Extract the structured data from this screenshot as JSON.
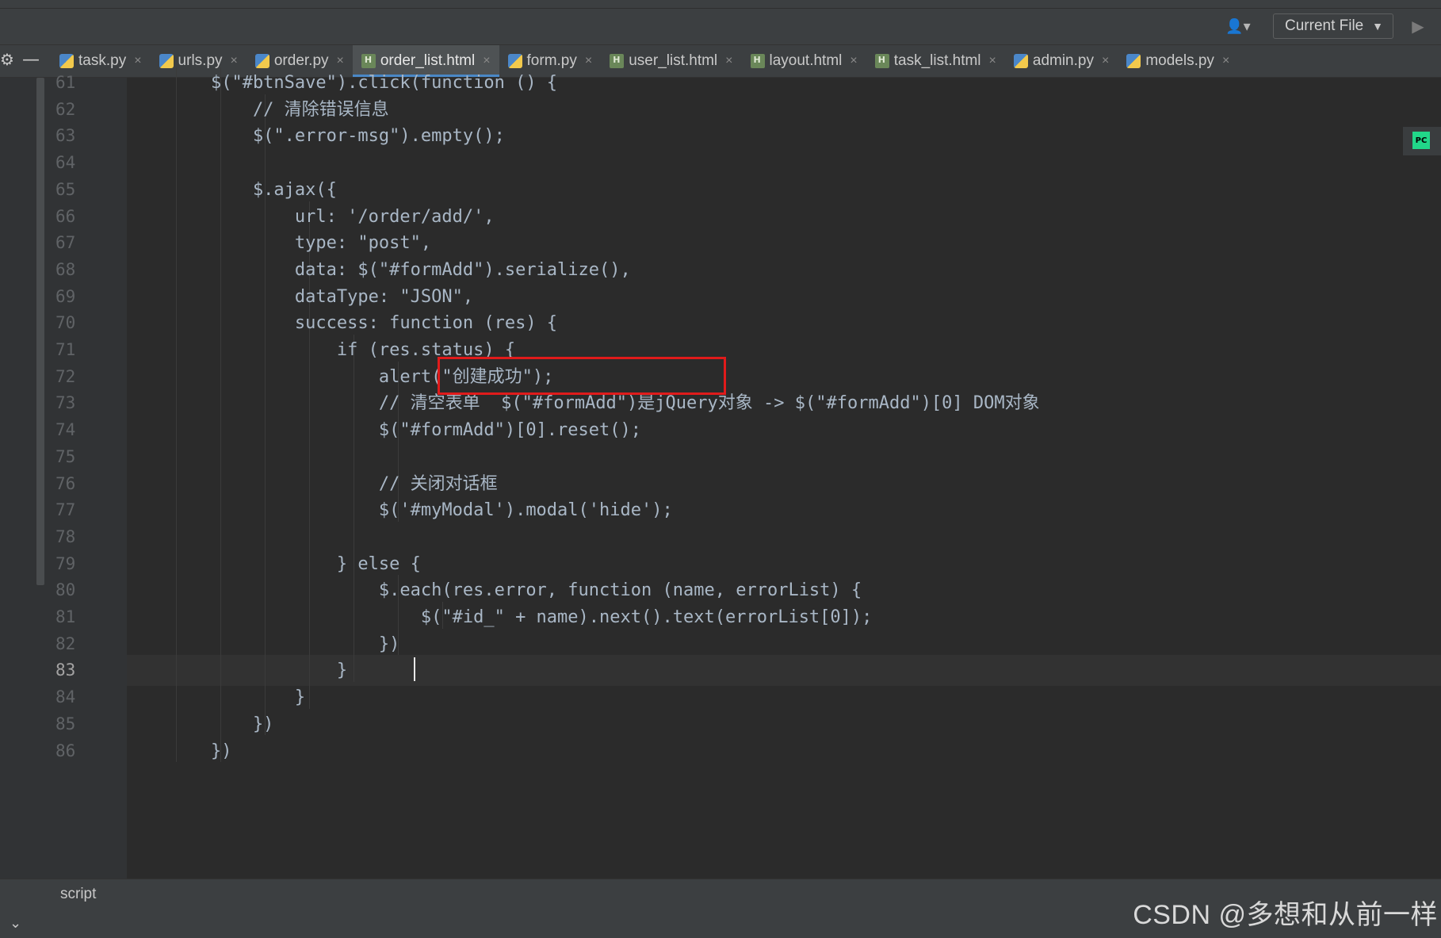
{
  "toolbar": {
    "current_file_label": "Current File",
    "user_icon": "user-icon",
    "run_icon": "run-icon"
  },
  "tabs": [
    {
      "label": "task.py",
      "type": "py",
      "active": false
    },
    {
      "label": "urls.py",
      "type": "py",
      "active": false
    },
    {
      "label": "order.py",
      "type": "py",
      "active": false
    },
    {
      "label": "order_list.html",
      "type": "html",
      "active": true
    },
    {
      "label": "form.py",
      "type": "py",
      "active": false
    },
    {
      "label": "user_list.html",
      "type": "html",
      "active": false
    },
    {
      "label": "layout.html",
      "type": "html",
      "active": false
    },
    {
      "label": "task_list.html",
      "type": "html",
      "active": false
    },
    {
      "label": "admin.py",
      "type": "py",
      "active": false
    },
    {
      "label": "models.py",
      "type": "py",
      "active": false
    }
  ],
  "editor": {
    "lines": [
      {
        "no": "61",
        "text": "        $(\"#btnSave\").click(function () {"
      },
      {
        "no": "62",
        "text": "            // 清除错误信息"
      },
      {
        "no": "63",
        "text": "            $(\".error-msg\").empty();"
      },
      {
        "no": "64",
        "text": ""
      },
      {
        "no": "65",
        "text": "            $.ajax({"
      },
      {
        "no": "66",
        "text": "                url: '/order/add/',"
      },
      {
        "no": "67",
        "text": "                type: \"post\","
      },
      {
        "no": "68",
        "text": "                data: $(\"#formAdd\").serialize(),"
      },
      {
        "no": "69",
        "text": "                dataType: \"JSON\","
      },
      {
        "no": "70",
        "text": "                success: function (res) {"
      },
      {
        "no": "71",
        "text": "                    if (res.status) {"
      },
      {
        "no": "72",
        "text": "                        alert(\"创建成功\");"
      },
      {
        "no": "73",
        "text": "                        // 清空表单  $(\"#formAdd\")是jQuery对象 -> $(\"#formAdd\")[0] DOM对象"
      },
      {
        "no": "74",
        "text": "                        $(\"#formAdd\")[0].reset();"
      },
      {
        "no": "75",
        "text": ""
      },
      {
        "no": "76",
        "text": "                        // 关闭对话框"
      },
      {
        "no": "77",
        "text": "                        $('#myModal').modal('hide');"
      },
      {
        "no": "78",
        "text": ""
      },
      {
        "no": "79",
        "text": "                    } else {"
      },
      {
        "no": "80",
        "text": "                        $.each(res.error, function (name, errorList) {"
      },
      {
        "no": "81",
        "text": "                            $(\"#id_\" + name).next().text(errorList[0]);"
      },
      {
        "no": "82",
        "text": "                        })"
      },
      {
        "no": "83",
        "text": "                    }"
      },
      {
        "no": "84",
        "text": "                }"
      },
      {
        "no": "85",
        "text": "            })"
      },
      {
        "no": "86",
        "text": "        })"
      }
    ],
    "current_line": "83"
  },
  "status": {
    "breadcrumb": "script"
  },
  "watermark": "CSDN @多想和从前一样",
  "colors": {
    "background": "#2b2b2b",
    "highlight_border": "#e01b1b",
    "active_tab_underline": "#4a88c7"
  }
}
